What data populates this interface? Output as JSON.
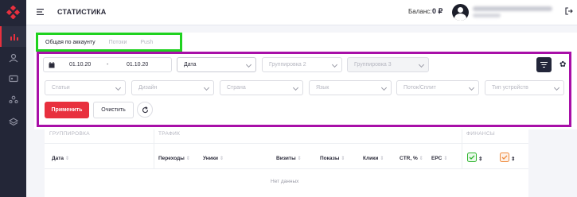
{
  "sidebar": {
    "logo_icon": "diamond-logo-icon",
    "items": [
      {
        "icon": "bar-chart-icon",
        "active": true
      },
      {
        "icon": "user-money-icon",
        "active": false
      },
      {
        "icon": "id-card-icon",
        "active": false
      },
      {
        "icon": "users-group-icon",
        "active": false
      },
      {
        "icon": "stack-icon",
        "active": false
      }
    ]
  },
  "header": {
    "title": "СТАТИСТИКА",
    "balance_label": "Баланс:",
    "balance_value": "0 ₽"
  },
  "tabs": [
    {
      "label": "Общая по аккаунту",
      "active": true
    },
    {
      "label": "Потоки",
      "active": false
    },
    {
      "label": "Push",
      "active": false
    }
  ],
  "filters": {
    "date_from": "01.10.20",
    "date_separator": "-",
    "date_to": "01.10.20",
    "grouping1": "Дата",
    "grouping2": "Группировка 2",
    "grouping3": "Группировка 3",
    "row2": [
      "Статьи",
      "Дизайн",
      "Страна",
      "Язык",
      "Поток/Сплит",
      "Тип устройств"
    ]
  },
  "buttons": {
    "apply": "Применить",
    "clear": "Очистить"
  },
  "table": {
    "groups": {
      "grouping": "ГРУППИРОВКА",
      "traffic": "ТРАФИК",
      "finance": "ФИНАНСЫ"
    },
    "columns": [
      "Дата",
      "Переходы",
      "Уники",
      "Визиты",
      "Показы",
      "Клики",
      "CTR, %",
      "EPC"
    ],
    "sort_glyph": "⇕",
    "empty": "Нет данных"
  },
  "colors": {
    "accent": "#e8303e",
    "sidebar": "#232637",
    "highlight_tabs": "#1fd21f",
    "highlight_filters": "#a80fa8"
  }
}
